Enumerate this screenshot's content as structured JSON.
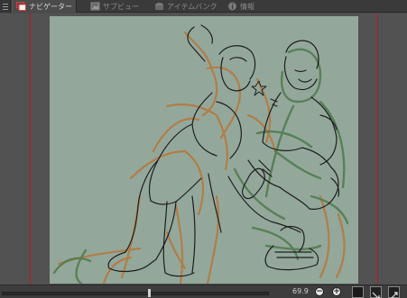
{
  "tabs": [
    {
      "label": "ナビゲーター",
      "icon": "navigator-icon",
      "active": true
    },
    {
      "label": "サブビュー",
      "icon": "subview-icon",
      "active": false
    },
    {
      "label": "アイテムバンク",
      "icon": "item-bank-icon",
      "active": false
    },
    {
      "label": "情報",
      "icon": "info-icon",
      "active": false
    }
  ],
  "colors": {
    "guide_line": "#c0181c",
    "canvas_bg": "#93a89b",
    "sketch_orange": "#b5793f",
    "sketch_green": "#4f7a4c",
    "sketch_black": "#1e1e1e"
  },
  "footer": {
    "zoom_value": "69.9",
    "zoom_position": 0.55,
    "zoom_out_symbol": "−",
    "zoom_in_symbol": "+",
    "buttons": [
      "fit-view-icon",
      "rotate-view-icon"
    ]
  }
}
